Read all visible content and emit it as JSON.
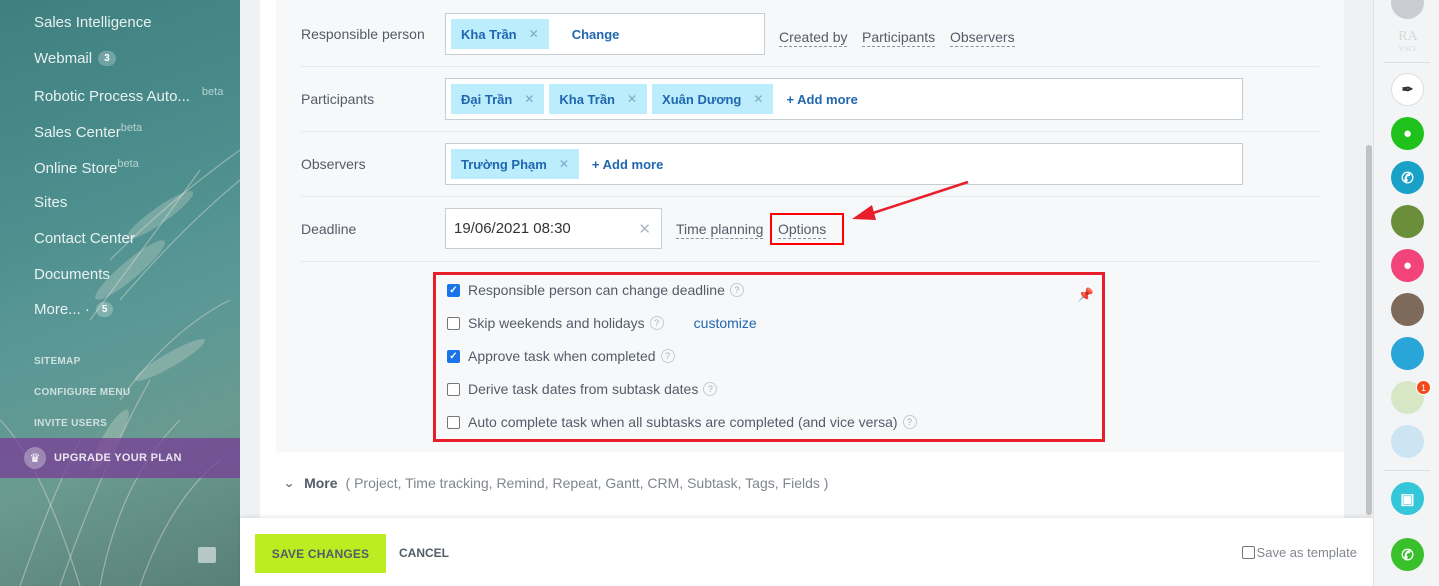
{
  "sidebar": {
    "items": [
      {
        "label": "Sales Intelligence"
      },
      {
        "label": "Webmail",
        "counter": "3"
      },
      {
        "label": "Robotic Process Auto...",
        "badge": "beta"
      },
      {
        "label": "Sales Center",
        "badge": "beta"
      },
      {
        "label": "Online Store",
        "badge": "beta"
      },
      {
        "label": "Sites"
      },
      {
        "label": "Contact Center"
      },
      {
        "label": "Documents"
      },
      {
        "label": "More... ·",
        "counter": "5"
      }
    ],
    "links": [
      "SITEMAP",
      "CONFIGURE MENU",
      "INVITE USERS"
    ],
    "upgrade": "UPGRADE YOUR PLAN"
  },
  "form": {
    "responsible": {
      "label": "Responsible person",
      "tag": "Kha Trần",
      "change": "Change",
      "links": [
        "Created by",
        "Participants",
        "Observers"
      ]
    },
    "participants": {
      "label": "Participants",
      "tags": [
        "Đại Trần",
        "Kha Trần",
        "Xuân Dương"
      ],
      "add_more": "+ Add more"
    },
    "observers": {
      "label": "Observers",
      "tags": [
        "Trường Phạm"
      ],
      "add_more": "+ Add more"
    },
    "deadline": {
      "label": "Deadline",
      "value": "19/06/2021 08:30",
      "time_planning": "Time planning",
      "options": "Options"
    },
    "options": [
      {
        "label": "Responsible person can change deadline",
        "checked": true
      },
      {
        "label": "Skip weekends and holidays",
        "checked": false,
        "link": "customize"
      },
      {
        "label": "Approve task when completed",
        "checked": true
      },
      {
        "label": "Derive task dates from subtask dates",
        "checked": false
      },
      {
        "label": "Auto complete task when all subtasks are completed (and vice versa)",
        "checked": false
      }
    ],
    "more": {
      "title": "More",
      "items": "( Project,  Time tracking,  Remind,  Repeat,  Gantt,  CRM,  Subtask,  Tags,  Fields )"
    }
  },
  "footer": {
    "save": "SAVE CHANGES",
    "cancel": "CANCEL",
    "save_template": "Save as template"
  },
  "rightbar": {
    "logo": "RA",
    "logo_sub": "VNCF",
    "badge": "1"
  },
  "colors": {
    "accent_green": "#bbed21",
    "link_blue": "#2067b0",
    "tag_bg": "#bcedfc",
    "annotation_red": "#e81f2b"
  }
}
